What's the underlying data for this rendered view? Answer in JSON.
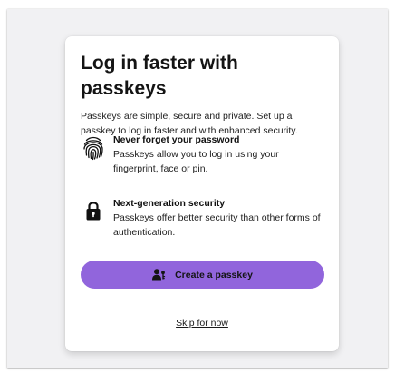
{
  "card": {
    "title": "Log in faster with passkeys",
    "intro": "Passkeys are simple, secure and private. Set up a passkey to log in faster and with enhanced security."
  },
  "features": [
    {
      "icon": "fingerprint-icon",
      "title": "Never forget your password",
      "description": "Passkeys allow you to log in using your fingerprint, face or pin."
    },
    {
      "icon": "lock-icon",
      "title": "Next-generation security",
      "description": "Passkeys offer better security than other forms of authentication."
    }
  ],
  "actions": {
    "create_label": "Create a passkey",
    "create_icon": "user-key-icon",
    "skip_label": "Skip for now"
  },
  "colors": {
    "accent": "#9165dc",
    "backdrop": "#f1f1f3",
    "card": "#ffffff",
    "text": "#141414"
  }
}
